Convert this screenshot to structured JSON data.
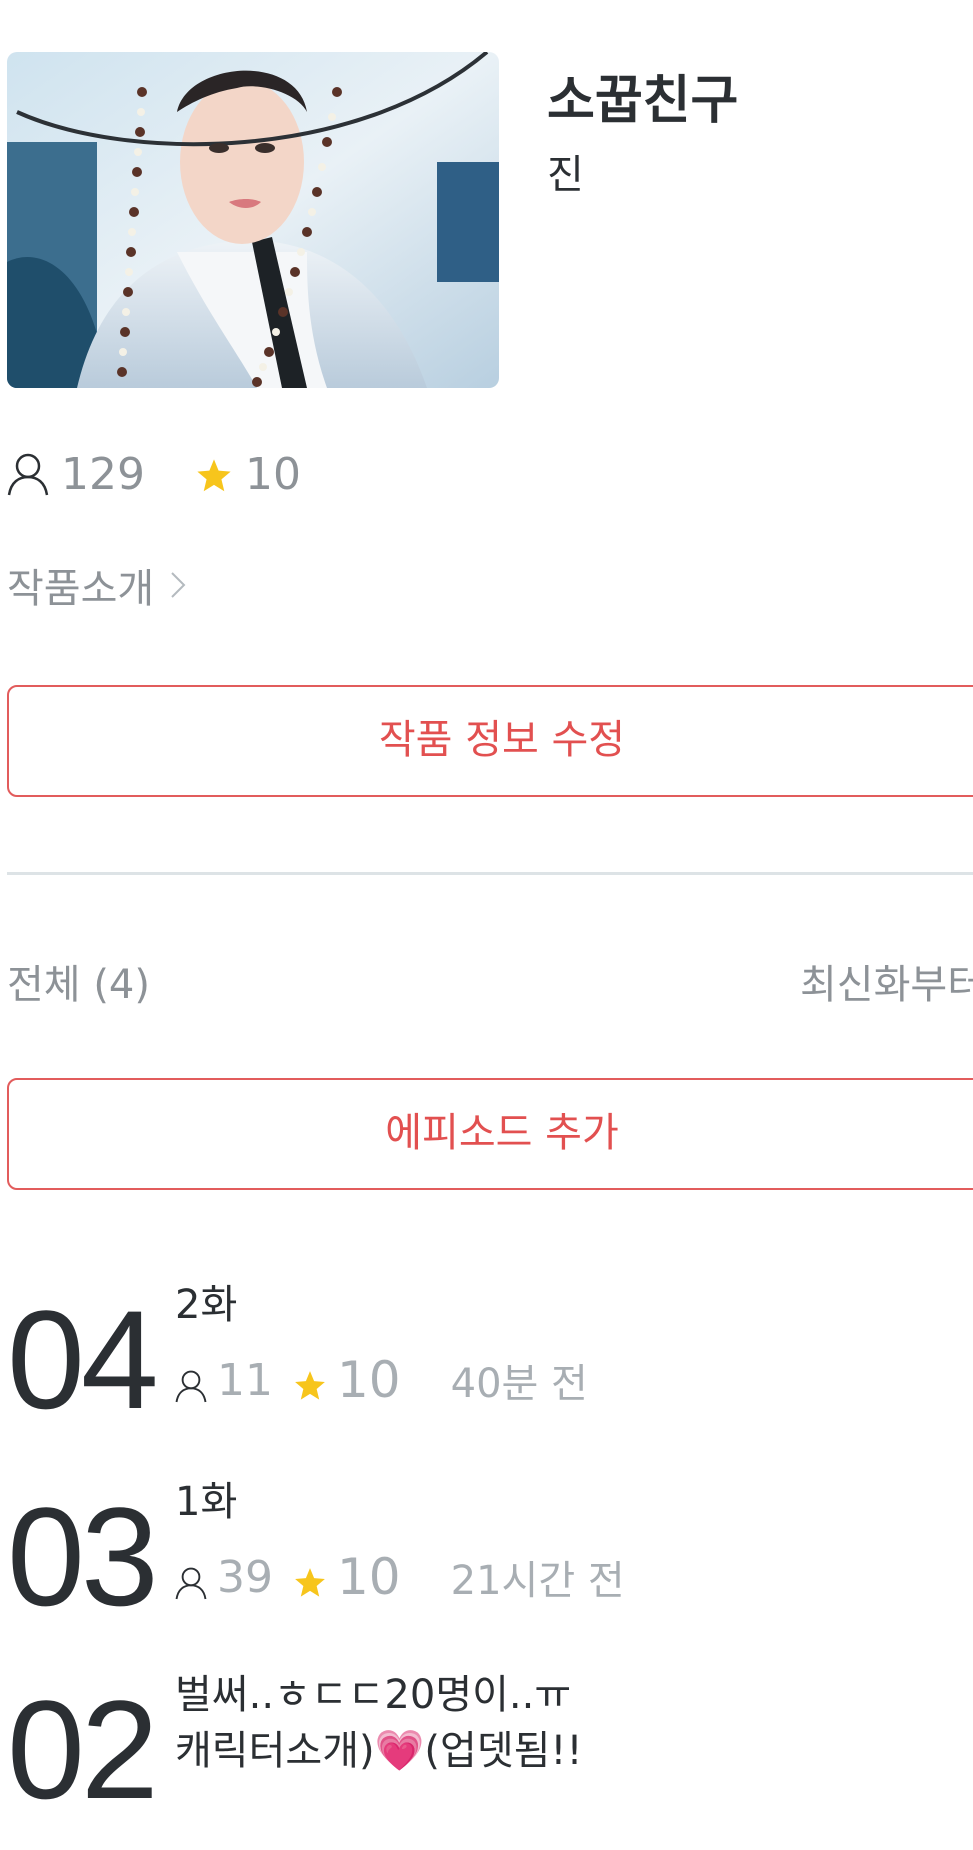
{
  "work": {
    "title": "소꿉친구",
    "author": "진",
    "views": "129",
    "rating": "10",
    "cover_icon": "cover-image"
  },
  "intro": {
    "label": "작품소개"
  },
  "buttons": {
    "edit_info": "작품 정보 수정",
    "add_episode": "에피소드 추가"
  },
  "list": {
    "total_label": "전체 (4)",
    "sort_label": "최신화부터"
  },
  "episodes": [
    {
      "number": "04",
      "title": "2화",
      "views": "11",
      "rating": "10",
      "time": "40분 전"
    },
    {
      "number": "03",
      "title": "1화",
      "views": "39",
      "rating": "10",
      "time": "21시간 전"
    },
    {
      "number": "02",
      "title": "벌써..ㅎㄷㄷ20명이..ㅠ",
      "title_line2": "캐릭터소개)💗(업뎃됨!!"
    }
  ],
  "colors": {
    "accent": "#e25050",
    "star": "#f7c51c",
    "muted": "#8d9297",
    "text": "#2b2f33"
  }
}
